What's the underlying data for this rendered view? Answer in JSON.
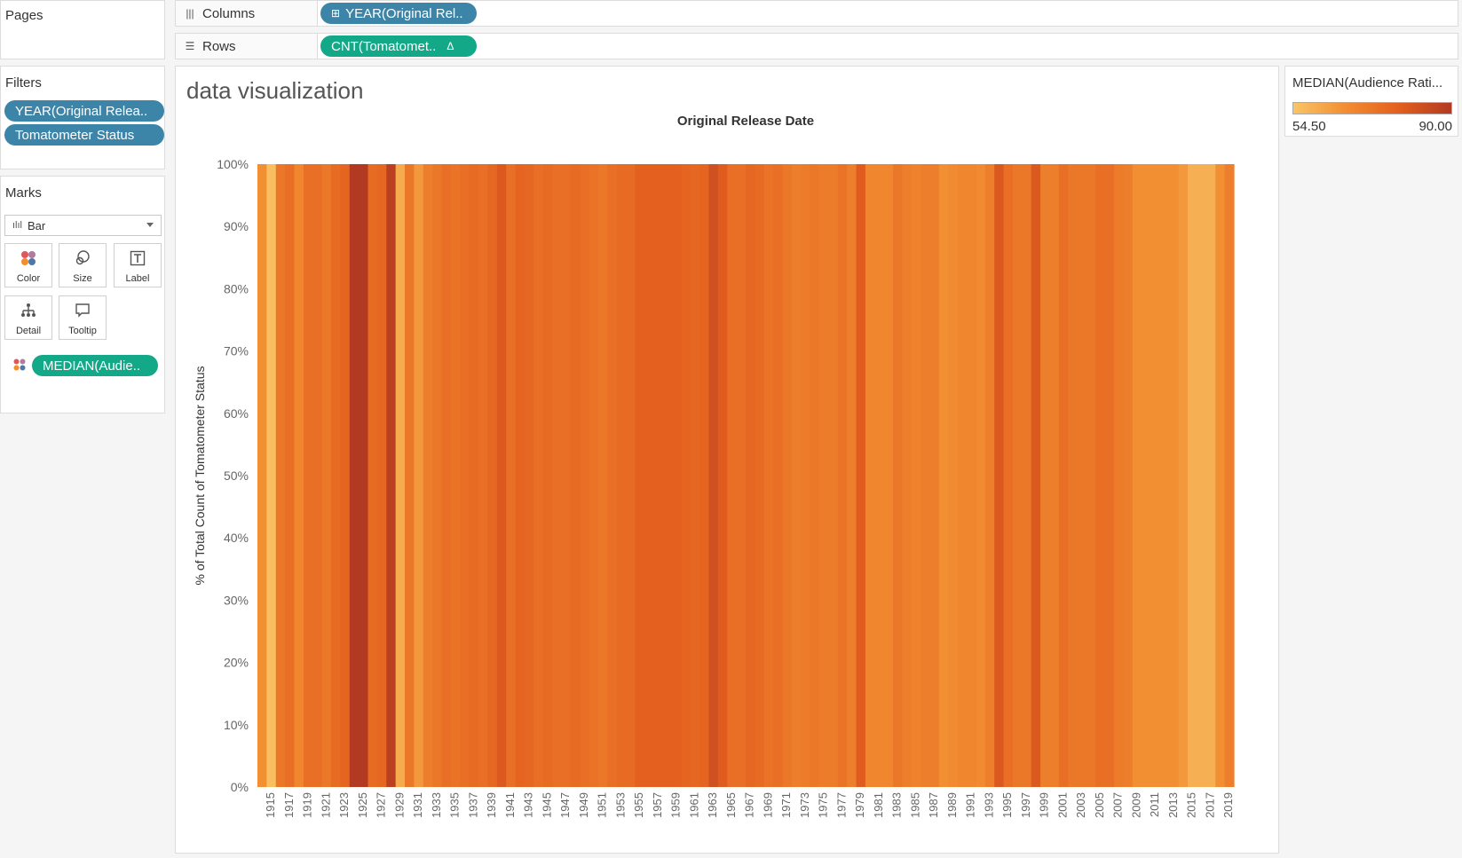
{
  "pages": {
    "title": "Pages"
  },
  "shelves": {
    "columns": {
      "label": "Columns",
      "pill": "YEAR(Original Rel.."
    },
    "rows": {
      "label": "Rows",
      "pill": "CNT(Tomatomet..",
      "pill_suffix": "Δ"
    }
  },
  "filters": {
    "title": "Filters",
    "items": [
      "YEAR(Original Relea..",
      "Tomatometer Status"
    ]
  },
  "marks": {
    "title": "Marks",
    "mark_type": "Bar",
    "cards": [
      "Color",
      "Size",
      "Label",
      "Detail",
      "Tooltip"
    ],
    "color_pill": "MEDIAN(Audie.."
  },
  "legend": {
    "title": "MEDIAN(Audience Rati...",
    "min_label": "54.50",
    "max_label": "90.00",
    "colors": [
      "#f9c567",
      "#f28d32",
      "#e35f1e",
      "#b23a22"
    ]
  },
  "worksheet": {
    "title": "data visualization"
  },
  "colors": {
    "blue_pill": "#3c85a8",
    "green_pill": "#13a888"
  },
  "chart_data": {
    "type": "bar",
    "title": "Original Release Date",
    "ylabel": "% of Total Count of Tomatometer Status",
    "ylim": [
      0,
      100
    ],
    "y_ticks": [
      "0%",
      "10%",
      "20%",
      "30%",
      "40%",
      "50%",
      "60%",
      "70%",
      "80%",
      "90%",
      "100%"
    ],
    "color_measure": "MEDIAN(Audience Rating)",
    "color_range": [
      54.5,
      90.0
    ],
    "x": [
      1914,
      1915,
      1916,
      1917,
      1918,
      1919,
      1920,
      1921,
      1922,
      1923,
      1924,
      1925,
      1926,
      1927,
      1928,
      1929,
      1930,
      1931,
      1932,
      1933,
      1934,
      1935,
      1936,
      1937,
      1938,
      1939,
      1940,
      1941,
      1942,
      1943,
      1944,
      1945,
      1946,
      1947,
      1948,
      1949,
      1950,
      1951,
      1952,
      1953,
      1954,
      1955,
      1956,
      1957,
      1958,
      1959,
      1960,
      1961,
      1962,
      1963,
      1964,
      1965,
      1966,
      1967,
      1968,
      1969,
      1970,
      1971,
      1972,
      1973,
      1974,
      1975,
      1976,
      1977,
      1978,
      1979,
      1980,
      1981,
      1982,
      1983,
      1984,
      1985,
      1986,
      1987,
      1988,
      1989,
      1990,
      1991,
      1992,
      1993,
      1994,
      1995,
      1996,
      1997,
      1998,
      1999,
      2000,
      2001,
      2002,
      2003,
      2004,
      2005,
      2006,
      2007,
      2008,
      2009,
      2010,
      2011,
      2012,
      2013,
      2014,
      2015,
      2016,
      2017,
      2018,
      2019
    ],
    "x_tick_labels": [
      "1915",
      "1917",
      "1919",
      "1921",
      "1923",
      "1925",
      "1927",
      "1929",
      "1931",
      "1933",
      "1935",
      "1937",
      "1939",
      "1941",
      "1943",
      "1945",
      "1947",
      "1949",
      "1951",
      "1953",
      "1955",
      "1957",
      "1959",
      "1961",
      "1963",
      "1965",
      "1967",
      "1969",
      "1971",
      "1973",
      "1975",
      "1977",
      "1979",
      "1981",
      "1983",
      "1985",
      "1987",
      "1989",
      "1991",
      "1993",
      "1995",
      "1997",
      "1999",
      "2001",
      "2003",
      "2005",
      "2007",
      "2009",
      "2011",
      "2013",
      "2015",
      "2017",
      "2019"
    ],
    "values": [
      100,
      100,
      100,
      100,
      100,
      100,
      100,
      100,
      100,
      100,
      100,
      100,
      100,
      100,
      100,
      100,
      100,
      100,
      100,
      100,
      100,
      100,
      100,
      100,
      100,
      100,
      100,
      100,
      100,
      100,
      100,
      100,
      100,
      100,
      100,
      100,
      100,
      100,
      100,
      100,
      100,
      100,
      100,
      100,
      100,
      100,
      100,
      100,
      100,
      100,
      100,
      100,
      100,
      100,
      100,
      100,
      100,
      100,
      100,
      100,
      100,
      100,
      100,
      100,
      100,
      100,
      100,
      100,
      100,
      100,
      100,
      100,
      100,
      100,
      100,
      100,
      100,
      100,
      100,
      100,
      100,
      100,
      100,
      100,
      100,
      100,
      100,
      100,
      100,
      100,
      100,
      100,
      100,
      100,
      100,
      100,
      100,
      100,
      100,
      100,
      100,
      100,
      100,
      100,
      100,
      100
    ],
    "median_audience": [
      66,
      56,
      72,
      74,
      68,
      74,
      74,
      72,
      75,
      77,
      90,
      90,
      75,
      76,
      88,
      60,
      72,
      64,
      70,
      72,
      74,
      73,
      74,
      75,
      74,
      76,
      80,
      74,
      77,
      76,
      74,
      75,
      74,
      74,
      75,
      74,
      73,
      72,
      74,
      75,
      75,
      78,
      78,
      78,
      78,
      78,
      77,
      76,
      77,
      83,
      79,
      74,
      74,
      76,
      75,
      73,
      74,
      72,
      70,
      71,
      72,
      71,
      71,
      73,
      70,
      79,
      68,
      68,
      68,
      72,
      70,
      69,
      70,
      70,
      66,
      67,
      68,
      68,
      67,
      70,
      80,
      74,
      72,
      72,
      80,
      70,
      70,
      74,
      72,
      72,
      72,
      74,
      74,
      71,
      70,
      66,
      66,
      66,
      66,
      66,
      64,
      59,
      59,
      59,
      66,
      70
    ]
  }
}
